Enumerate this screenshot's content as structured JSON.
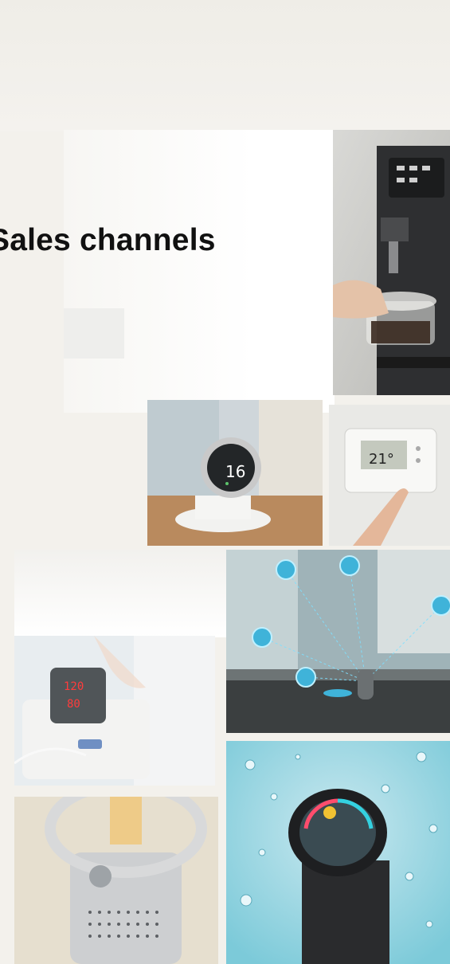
{
  "slide": {
    "title": "Sales channels"
  },
  "photos": [
    {
      "name": "coffee-machine-photo"
    },
    {
      "name": "round-thermostat-photo",
      "display_value": "16"
    },
    {
      "name": "wall-thermostat-photo",
      "display_value": "21°"
    },
    {
      "name": "smart-home-network-photo"
    },
    {
      "name": "blood-pressure-monitor-photo",
      "readings": [
        "120",
        "80"
      ]
    },
    {
      "name": "air-purifier-fan-photo"
    },
    {
      "name": "smartwatch-water-splash-photo"
    }
  ],
  "colors": {
    "background": "#f3f1ec",
    "title": "#111111",
    "accent_blue": "#3fb3d9"
  }
}
